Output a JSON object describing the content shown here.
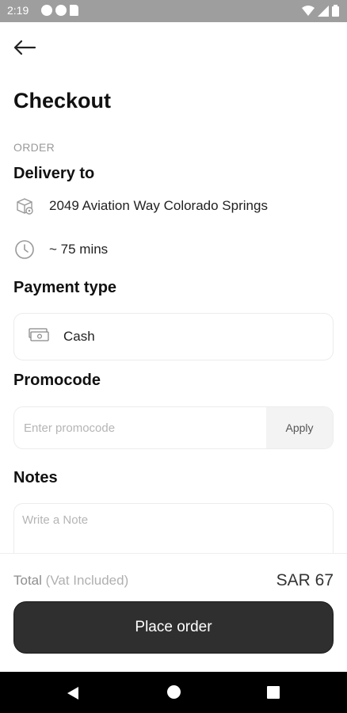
{
  "status_bar": {
    "time": "2:19",
    "icons": [
      "notification-icon",
      "notification-icon",
      "sdcard-icon",
      "wifi-icon",
      "signal-icon",
      "battery-icon"
    ]
  },
  "header": {
    "back_icon": "arrow-left-icon",
    "title": "Checkout"
  },
  "order": {
    "caption": "ORDER",
    "delivery_heading": "Delivery to",
    "address_icon": "location-box-icon",
    "address": "2049 Aviation Way Colorado Springs",
    "eta_icon": "clock-icon",
    "eta": "~ 75 mins"
  },
  "payment": {
    "heading": "Payment type",
    "method_icon": "cash-icon",
    "method": "Cash"
  },
  "promocode": {
    "heading": "Promocode",
    "placeholder": "Enter promocode",
    "value": "",
    "apply_label": "Apply"
  },
  "notes": {
    "heading": "Notes",
    "placeholder": "Write a Note",
    "value": ""
  },
  "summary": {
    "total_label": "Total",
    "vat_label": "(Vat Included)",
    "total_value": "SAR 67",
    "place_order_label": "Place order"
  },
  "nav_bar": {
    "buttons": [
      "nav-back-icon",
      "nav-home-icon",
      "nav-recents-icon"
    ]
  },
  "colors": {
    "status_bar": "#9e9e9e",
    "primary_button": "#2f2f2f",
    "muted_text": "#9a9a9a",
    "card_border": "#ececec"
  }
}
